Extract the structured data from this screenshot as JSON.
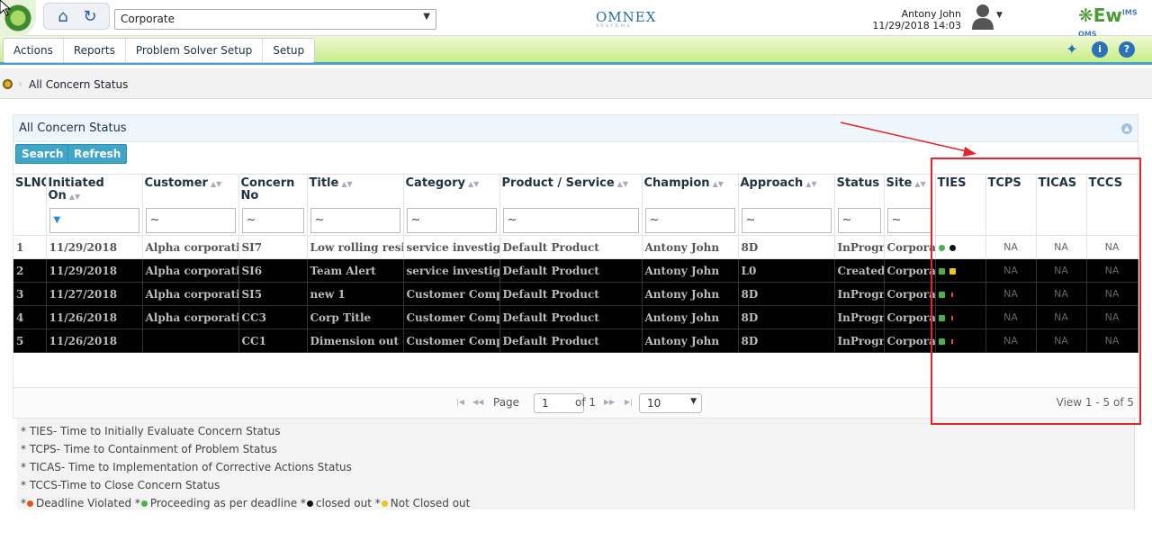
{
  "topbar": {
    "site_value": "Corporate",
    "brand_name": "OMNEX",
    "brand_sub": "SYSTEMS",
    "user_name": "Antony John",
    "user_datetime": "11/29/2018 14:03",
    "product_logo": "Ew",
    "product_logo_sup": "IMS QMS"
  },
  "menu": {
    "items": [
      "Actions",
      "Reports",
      "Problem Solver Setup",
      "Setup"
    ]
  },
  "breadcrumb": {
    "current": "All Concern Status"
  },
  "panel": {
    "title": "All Concern Status",
    "search_label": "Search",
    "refresh_label": "Refresh"
  },
  "grid": {
    "columns": [
      "SLNO",
      "Initiated On",
      "Customer",
      "Concern No",
      "Title",
      "Category",
      "Product / Service",
      "Champion",
      "Approach",
      "Status",
      "Site",
      "TIES",
      "TCPS",
      "TICAS",
      "TCCS"
    ],
    "filter_symbol": "~",
    "rows": [
      {
        "sl": "1",
        "date": "11/29/2018",
        "customer": "Alpha corporation",
        "no": "SI7",
        "title": "Low rolling resistance",
        "category": "service investigation",
        "product": "Default Product",
        "champion": "Antony John",
        "approach": "8D",
        "status": "InProgress",
        "site": "Corporate",
        "tcps": "NA",
        "ticas": "NA",
        "tccs": "NA"
      },
      {
        "sl": "2",
        "date": "11/29/2018",
        "customer": "Alpha corporation",
        "no": "SI6",
        "title": "Team Alert",
        "category": "service investigation",
        "product": "Default Product",
        "champion": "Antony John",
        "approach": "L0",
        "status": "Created",
        "site": "Corporate",
        "tcps": "NA",
        "ticas": "NA",
        "tccs": "NA"
      },
      {
        "sl": "3",
        "date": "11/27/2018",
        "customer": "Alpha corporation",
        "no": "SI5",
        "title": "new 1",
        "category": "Customer Complaint",
        "product": "Default Product",
        "champion": "Antony John",
        "approach": "8D",
        "status": "InProgress",
        "site": "Corporate",
        "tcps": "NA",
        "ticas": "NA",
        "tccs": "NA"
      },
      {
        "sl": "4",
        "date": "11/26/2018",
        "customer": "Alpha corporation",
        "no": "CC3",
        "title": "Corp Title",
        "category": "Customer Complaint",
        "product": "Default Product",
        "champion": "Antony John",
        "approach": "8D",
        "status": "InProgress",
        "site": "Corporate",
        "tcps": "NA",
        "ticas": "NA",
        "tccs": "NA"
      },
      {
        "sl": "5",
        "date": "11/26/2018",
        "customer": "",
        "no": "CC1",
        "title": "Dimension out of spec",
        "category": "Customer Complaint",
        "product": "Default Product",
        "champion": "Antony John",
        "approach": "8D",
        "status": "InProgress",
        "site": "Corporate",
        "tcps": "NA",
        "ticas": "NA",
        "tccs": "NA"
      }
    ]
  },
  "pager": {
    "page_label": "Page",
    "page_value": "1",
    "of_label": "of 1",
    "page_size": "10",
    "view_text": "View 1 - 5 of 5"
  },
  "legend": {
    "ties": "* TIES- Time to Initially Evaluate Concern Status",
    "tcps": "* TCPS- Time to Containment of Problem Status",
    "ticas": "* TICAS- Time to Implementation of Corrective Actions Status",
    "tccs": "* TCCS-Time to Close Concern Status",
    "violated": "Deadline Violated",
    "proceeding": "Proceeding as per deadline",
    "closed": "closed out",
    "not_closed": "Not Closed out"
  },
  "colors": {
    "violated": "#e8501a",
    "proceeding": "#4caf50",
    "closed": "#111111",
    "not_closed": "#f0c419",
    "annotation": "#e0262b"
  }
}
